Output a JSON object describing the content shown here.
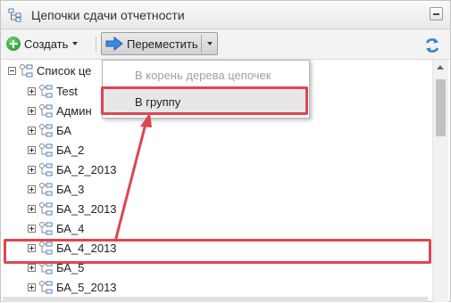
{
  "panel": {
    "title": "Цепочки сдачи отчетности"
  },
  "toolbar": {
    "create_label": "Создать",
    "move_label": "Переместить"
  },
  "dropdown": {
    "items": [
      {
        "label": "В корень дерева цепочек",
        "enabled": false
      },
      {
        "label": "В группу",
        "enabled": true
      }
    ]
  },
  "tree": {
    "root_label": "Список цепочек",
    "root_visible_label": "Список це",
    "nodes": [
      {
        "label": "Test"
      },
      {
        "label": "Админ"
      },
      {
        "label": "БА"
      },
      {
        "label": "БА_2"
      },
      {
        "label": "БА_2_2013"
      },
      {
        "label": "БА_3"
      },
      {
        "label": "БА_3_2013"
      },
      {
        "label": "БА_4"
      },
      {
        "label": "БА_4_2013",
        "selected": true
      },
      {
        "label": "БА_5"
      },
      {
        "label": "БА_5_2013"
      }
    ]
  },
  "colors": {
    "highlight": "#e04550",
    "accent_blue": "#2f86d6"
  }
}
